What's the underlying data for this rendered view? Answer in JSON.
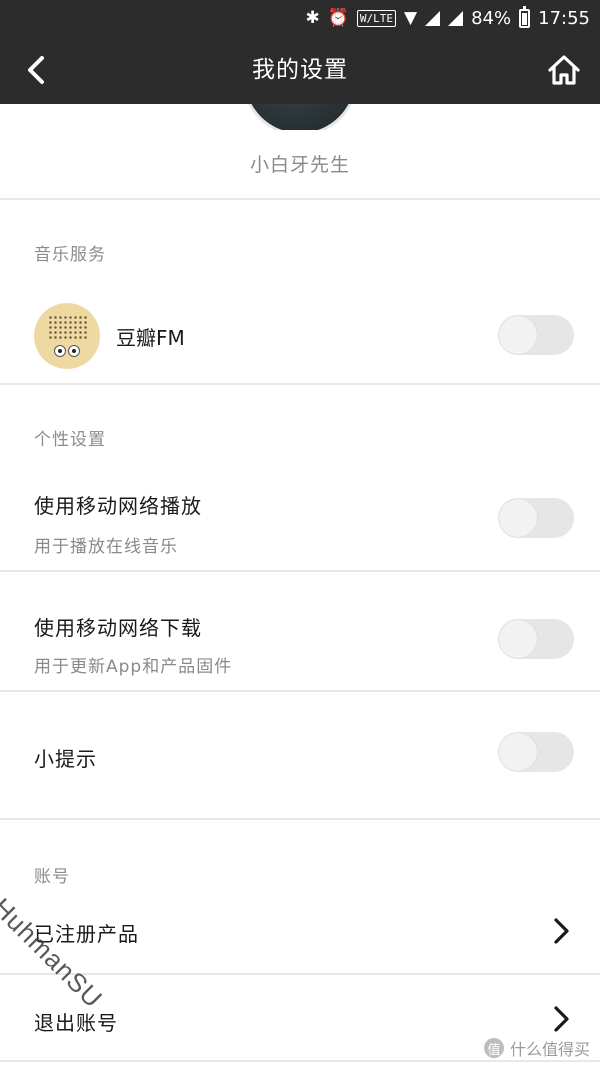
{
  "status_bar": {
    "lte_label": "W/LTE",
    "battery": "84%",
    "time": "17:55"
  },
  "header": {
    "title": "我的设置"
  },
  "profile": {
    "username": "小白牙先生"
  },
  "sections": {
    "music": {
      "label": "音乐服务",
      "app_name": "豆瓣FM",
      "enabled": false
    },
    "personal": {
      "label": "个性设置",
      "mobile_play_title": "使用移动网络播放",
      "mobile_play_sub": "用于播放在线音乐",
      "mobile_download_title": "使用移动网络下载",
      "mobile_download_sub": "用于更新App和产品固件",
      "tips_title": "小提示"
    },
    "account": {
      "label": "账号",
      "registered_products": "已注册产品",
      "logout": "退出账号"
    }
  },
  "watermark": "HuhmanSU",
  "site_watermark": "什么值得买",
  "colors": {
    "header_bg": "#2c2c2c",
    "toggle_off": "#e6e6e6",
    "divider": "#e8e8e8"
  }
}
